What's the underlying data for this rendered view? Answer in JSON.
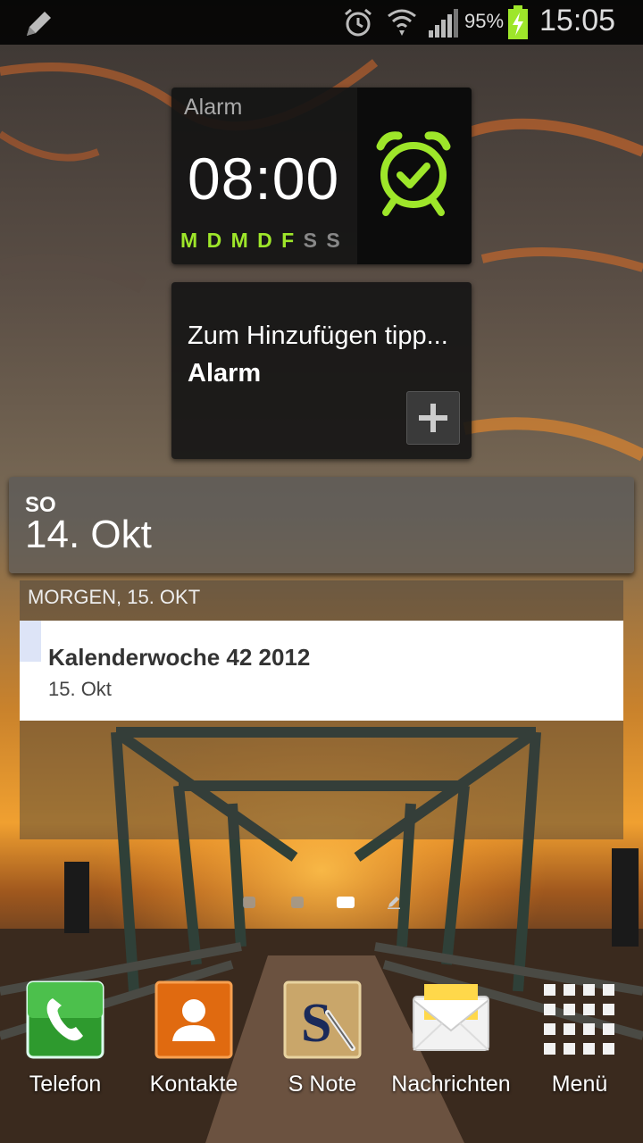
{
  "status_bar": {
    "battery_percent": "95%",
    "time": "15:05",
    "icons": [
      "pencil-icon",
      "alarm-icon",
      "wifi-icon",
      "signal-icon",
      "battery-charging-icon"
    ]
  },
  "alarm_widget": {
    "title": "Alarm",
    "time": "08:00",
    "days": [
      {
        "label": "M",
        "active": true
      },
      {
        "label": "D",
        "active": true
      },
      {
        "label": "M",
        "active": true
      },
      {
        "label": "D",
        "active": true
      },
      {
        "label": "F",
        "active": true
      },
      {
        "label": "S",
        "active": false
      },
      {
        "label": "S",
        "active": false
      }
    ],
    "accent_color": "#9ee62a"
  },
  "add_alarm_widget": {
    "line1": "Zum Hinzufügen tipp...",
    "line2": "Alarm"
  },
  "calendar_widget": {
    "weekday": "SO",
    "date": "14. Okt",
    "section_label": "MORGEN, 15. OKT",
    "events": [
      {
        "title": "Kalenderwoche 42 2012",
        "date": "15. Okt"
      }
    ]
  },
  "home_pages": {
    "count": 3,
    "active_index": 2
  },
  "dock": [
    {
      "label": "Telefon",
      "icon": "phone-icon"
    },
    {
      "label": "Kontakte",
      "icon": "contacts-icon"
    },
    {
      "label": "S Note",
      "icon": "s-note-icon"
    },
    {
      "label": "Nachrichten",
      "icon": "messages-icon"
    },
    {
      "label": "Menü",
      "icon": "apps-grid-icon"
    }
  ]
}
